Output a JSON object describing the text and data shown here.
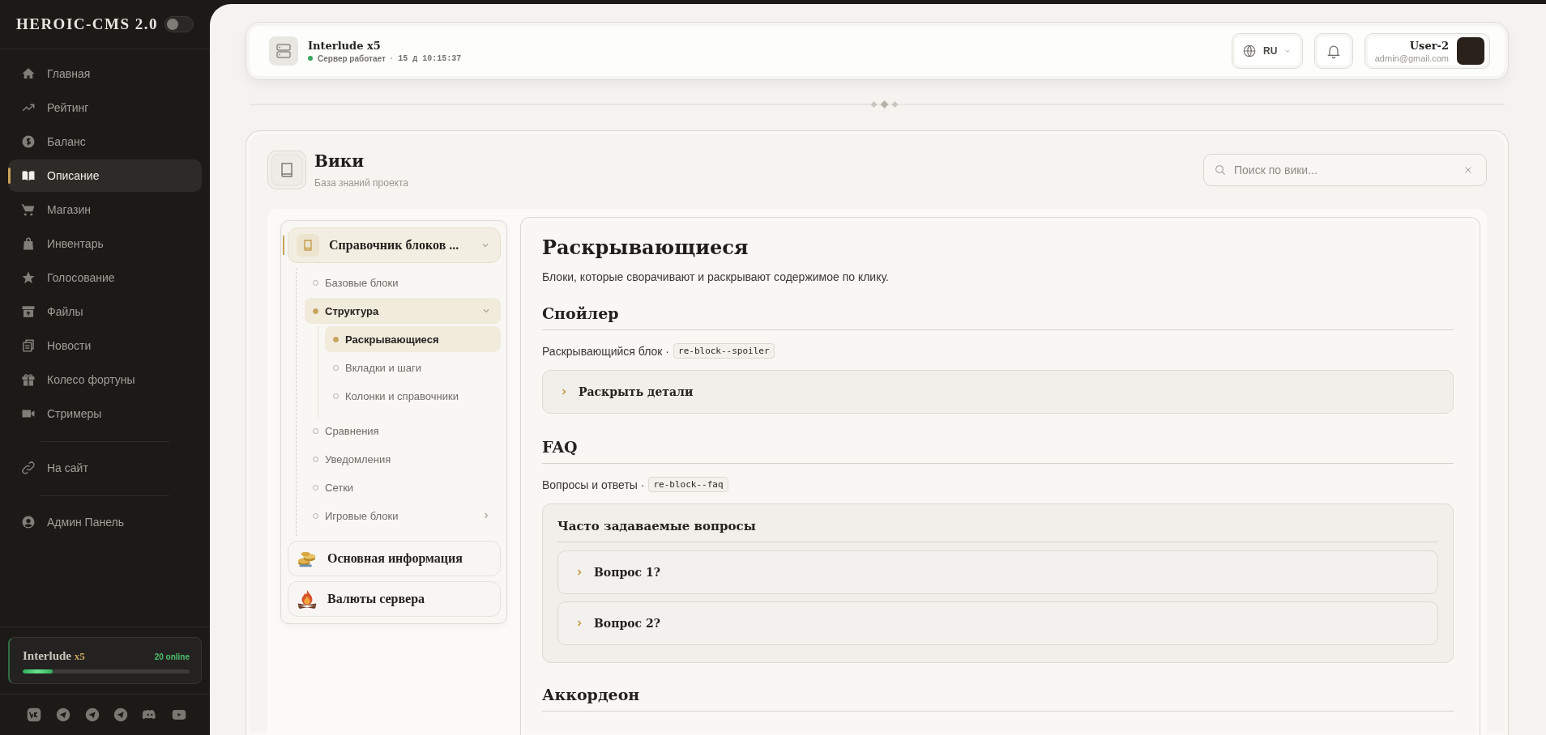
{
  "sidebar": {
    "logo": "HEROIC-CMS 2.0",
    "theme_toggle": {
      "on": false
    },
    "groups": [
      [
        {
          "label": "Главная",
          "selected": false
        },
        {
          "label": "Рейтинг",
          "selected": false
        },
        {
          "label": "Баланс",
          "selected": false
        },
        {
          "label": "Описание",
          "selected": true
        },
        {
          "label": "Магазин",
          "selected": false
        },
        {
          "label": "Инвентарь",
          "selected": false
        },
        {
          "label": "Голосование",
          "selected": false
        },
        {
          "label": "Файлы",
          "selected": false
        },
        {
          "label": "Новости",
          "selected": false
        },
        {
          "label": "Колесо фортуны",
          "selected": false
        },
        {
          "label": "Стримеры",
          "selected": false
        }
      ],
      [
        {
          "label": "На сайт",
          "selected": false
        }
      ],
      [
        {
          "label": "Админ Панель",
          "selected": false
        }
      ]
    ],
    "server_card": {
      "name": "Interlude",
      "rate": "x5",
      "online": "20 online",
      "level": 0.18
    }
  },
  "header": {
    "server": {
      "name": "Interlude x5",
      "online": true,
      "status": "Сервер работает",
      "separator": "·",
      "uptime": "15 д 10:15:37"
    },
    "language": "RU",
    "user": {
      "name": "User-2",
      "email": "admin@gmail.com"
    }
  },
  "wiki": {
    "title": "Вики",
    "subtitle": "База знаний проекта",
    "search": {
      "placeholder": "Поиск по вики..."
    },
    "nav": [
      {
        "title": "Справочник блоков ...",
        "selected": true,
        "expanded": true,
        "children": [
          {
            "label": "Базовые блоки",
            "selected": false
          },
          {
            "label": "Структура",
            "selected": true,
            "expanded": true,
            "children": [
              {
                "label": "Раскрывающиеся",
                "selected": true
              },
              {
                "label": "Вкладки и шаги",
                "selected": false
              },
              {
                "label": "Колонки и справочники",
                "selected": false
              }
            ]
          },
          {
            "label": "Сравнения",
            "selected": false
          },
          {
            "label": "Уведомления",
            "selected": false
          },
          {
            "label": "Сетки",
            "selected": false
          },
          {
            "label": "Игровые блоки",
            "selected": false,
            "expanded": false
          }
        ]
      },
      {
        "title": "Основная информация",
        "selected": false
      },
      {
        "title": "Валюты сервера",
        "selected": false
      }
    ],
    "article": {
      "title": "Раскрывающиеся",
      "intro": "Блоки, которые сворачивают и раскрывают содержимое по клику.",
      "sections": [
        {
          "kind": "spoiler",
          "heading": "Спойлер",
          "description": "Раскрывающийся блок ·",
          "code": "re-block--spoiler",
          "items": [
            {
              "label": "Раскрыть детали",
              "expanded": false
            }
          ]
        },
        {
          "kind": "faq",
          "heading": "FAQ",
          "description": "Вопросы и ответы ·",
          "code": "re-block--faq",
          "title": "Часто задаваемые вопросы",
          "items": [
            {
              "label": "Вопрос 1?",
              "expanded": false
            },
            {
              "label": "Вопрос 2?",
              "expanded": false
            }
          ]
        },
        {
          "kind": "heading",
          "heading": "Аккордеон"
        }
      ]
    }
  }
}
